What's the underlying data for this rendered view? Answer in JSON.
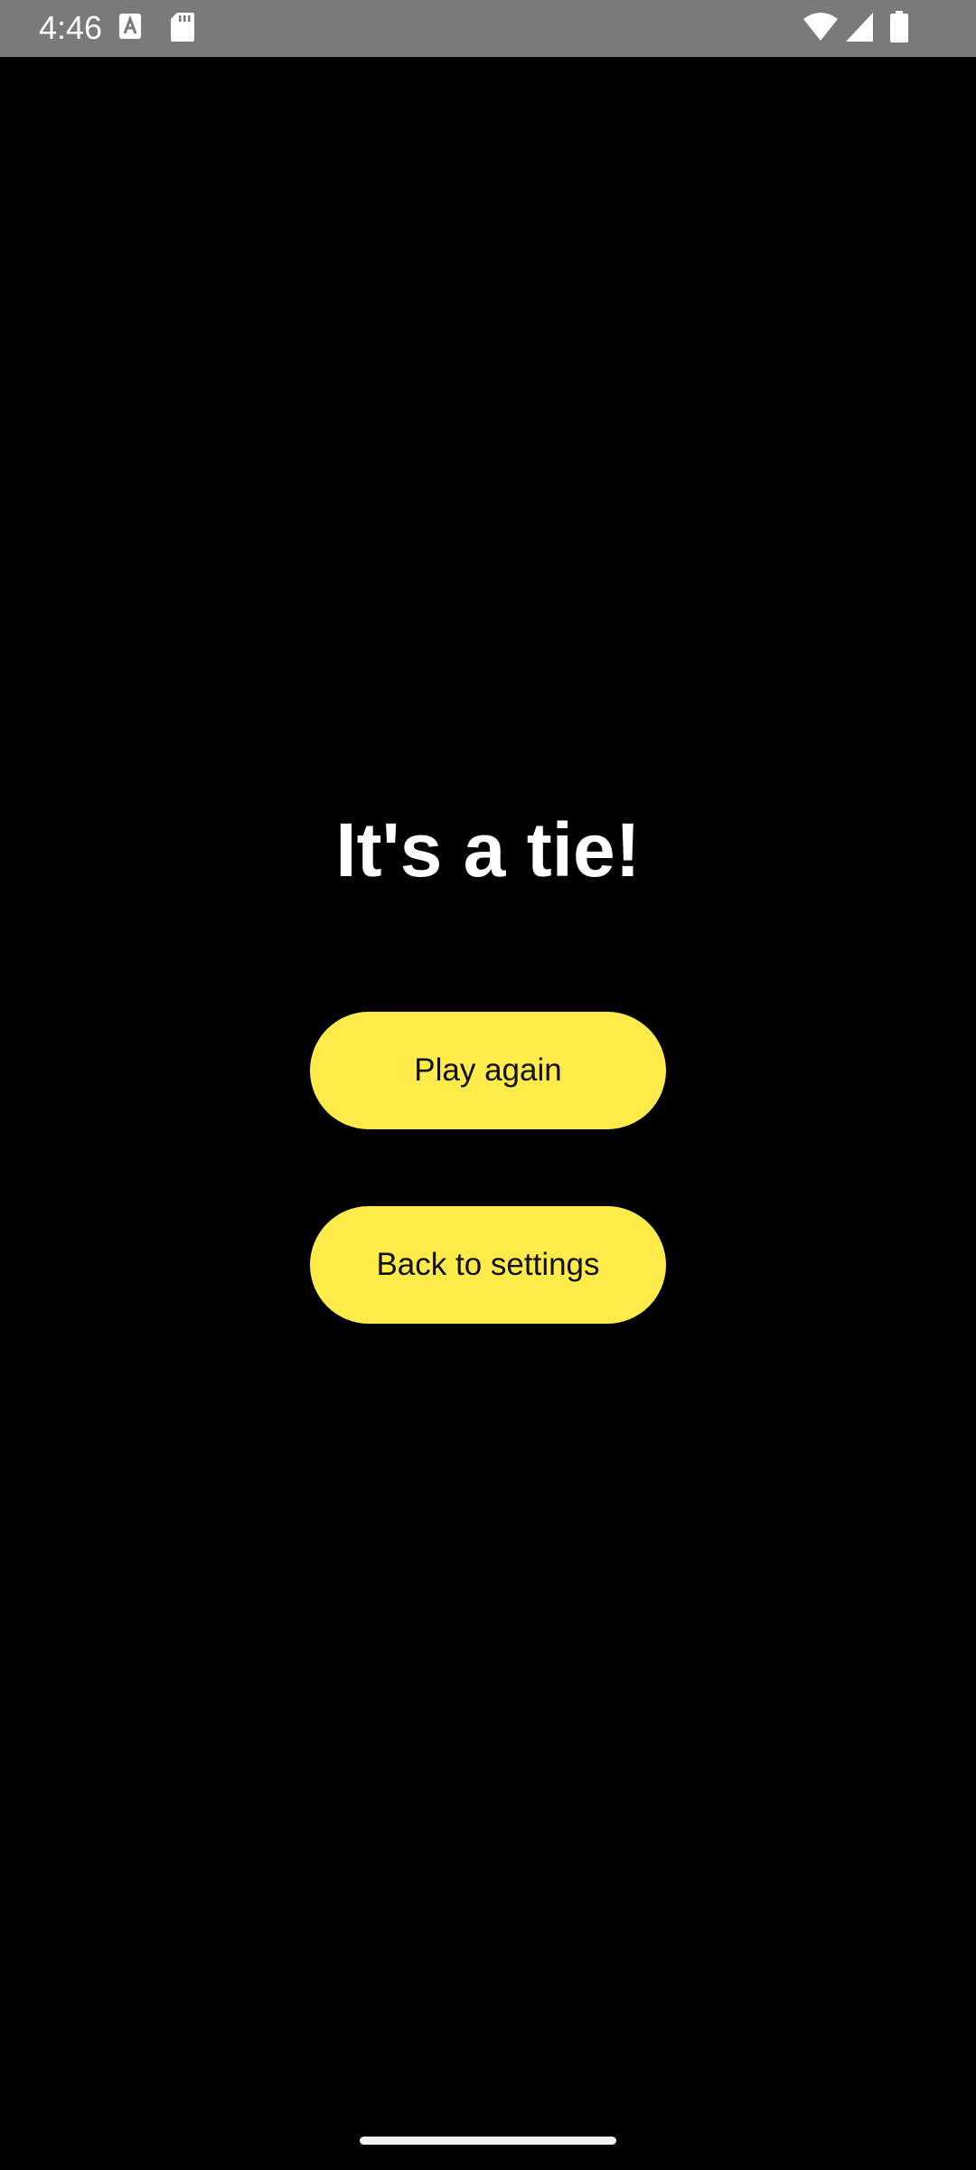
{
  "status_bar": {
    "time": "4:46",
    "icons": [
      "text-a-icon",
      "sd-card-icon",
      "wifi-icon",
      "cellular-signal-icon",
      "battery-icon"
    ]
  },
  "result": {
    "title": "It's a tie!"
  },
  "actions": {
    "play_again_label": "Play again",
    "back_to_settings_label": "Back to settings"
  },
  "colors": {
    "background": "#000000",
    "status_bar": "#7a7a7a",
    "button_fill": "#ffeb4a",
    "button_text": "#111111",
    "title_text": "#ffffff"
  }
}
